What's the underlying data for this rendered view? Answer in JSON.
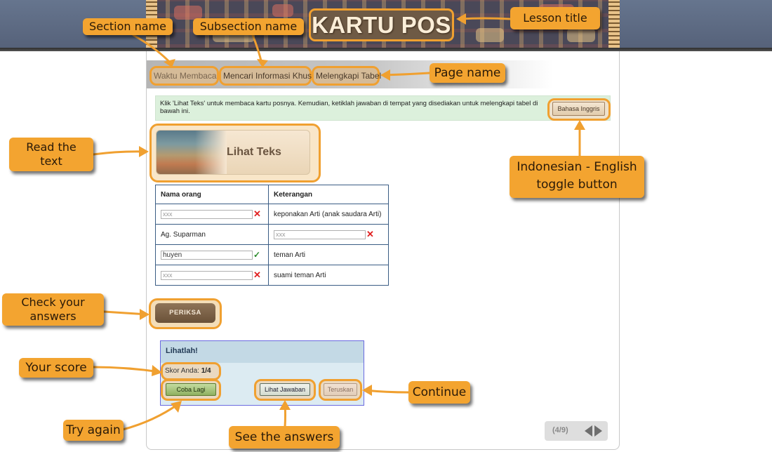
{
  "header": {
    "lesson_title": "KARTU POS"
  },
  "breadcrumb": {
    "section": "Waktu Membaca",
    "subsection": "Mencari Informasi Khusus",
    "page": "Melengkapi Tabel"
  },
  "instructions": {
    "text": "Klik 'Lihat Teks' untuk membaca kartu posnya. Kemudian, ketiklah jawaban di tempat yang disediakan untuk melengkapi tabel di bawah ini.",
    "language_toggle_label": "Bahasa Inggris"
  },
  "view_text_button": {
    "label": "Lihat Teks"
  },
  "table": {
    "headers": [
      "Nama orang",
      "Keterangan"
    ],
    "rows": [
      {
        "name": {
          "type": "input",
          "value": "xxx",
          "status": "wrong"
        },
        "description": {
          "type": "text",
          "value": "keponakan Arti (anak saudara Arti)"
        }
      },
      {
        "name": {
          "type": "text",
          "value": "Ag. Suparman"
        },
        "description": {
          "type": "input",
          "value": "xxx",
          "status": "wrong"
        }
      },
      {
        "name": {
          "type": "input",
          "value": "huyen",
          "status": "correct"
        },
        "description": {
          "type": "text",
          "value": "teman Arti"
        }
      },
      {
        "name": {
          "type": "input",
          "value": "xxx",
          "status": "wrong"
        },
        "description": {
          "type": "text",
          "value": "suami teman Arti"
        }
      }
    ],
    "wrong_mark": "✕",
    "correct_mark": "✓"
  },
  "check_button": {
    "label": "PERIKSA"
  },
  "feedback": {
    "title": "Lihatlah!",
    "score_label": "Skor Anda:",
    "score_value": "1/4",
    "try_again_label": "Coba Lagi",
    "see_answers_label": "Lihat Jawaban",
    "continue_label": "Teruskan"
  },
  "pager": {
    "count": "(4/9)",
    "current": 4,
    "total": 9
  },
  "annotations": {
    "section_name": "Section name",
    "subsection_name": "Subsection name",
    "lesson_title": "Lesson title",
    "page_name": "Page name",
    "read_text_line1": "Read the",
    "read_text_line2": "text",
    "language_toggle_line1": "Indonesian - English",
    "language_toggle_line2": "toggle button",
    "check_answers_line1": "Check your",
    "check_answers_line2": "answers",
    "your_score": "Your score",
    "try_again": "Try again",
    "see_answers": "See the answers",
    "continue": "Continue"
  },
  "colors": {
    "annotation_orange": "#f3a430",
    "header_slate": "#5e6b84",
    "table_border": "#3a5c84",
    "wrong": "#e02020",
    "correct": "#2a8a2a"
  }
}
